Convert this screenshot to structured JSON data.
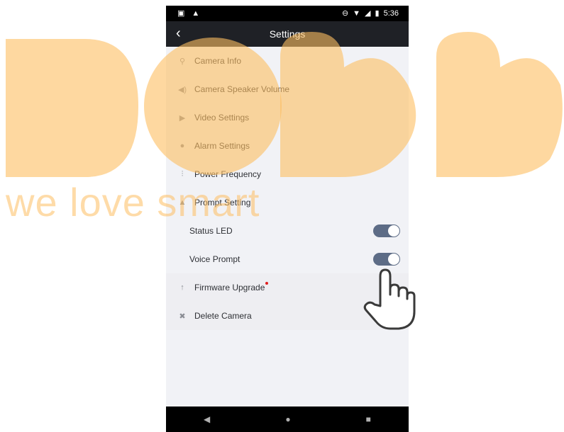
{
  "status_bar": {
    "time": "5:36"
  },
  "app_bar": {
    "title": "Settings",
    "back_icon": "chevron-left-icon"
  },
  "menu": [
    {
      "label": "Camera Info",
      "icon": "camera-icon"
    },
    {
      "label": "Camera Speaker Volume",
      "icon": "speaker-icon"
    },
    {
      "label": "Video Settings",
      "icon": "video-icon"
    },
    {
      "label": "Alarm Settings",
      "icon": "alarm-icon"
    },
    {
      "label": "Power Frequency",
      "icon": "frequency-icon"
    },
    {
      "label": "Prompt Setting",
      "icon": "warning-icon"
    }
  ],
  "prompt": {
    "status_led_label": "Status LED",
    "status_led_on": true,
    "voice_prompt_label": "Voice Prompt",
    "voice_prompt_on": true
  },
  "actions": [
    {
      "label": "Firmware Upgrade",
      "icon": "arrow-up-icon"
    },
    {
      "label": "Delete Camera",
      "icon": "delete-icon"
    }
  ],
  "watermark": {
    "tagline": "we love smart",
    "color": "#febe60"
  },
  "colors": {
    "toggle_on": "#5d6c86",
    "app_bar": "#1f2126",
    "badge": "#e02020"
  }
}
